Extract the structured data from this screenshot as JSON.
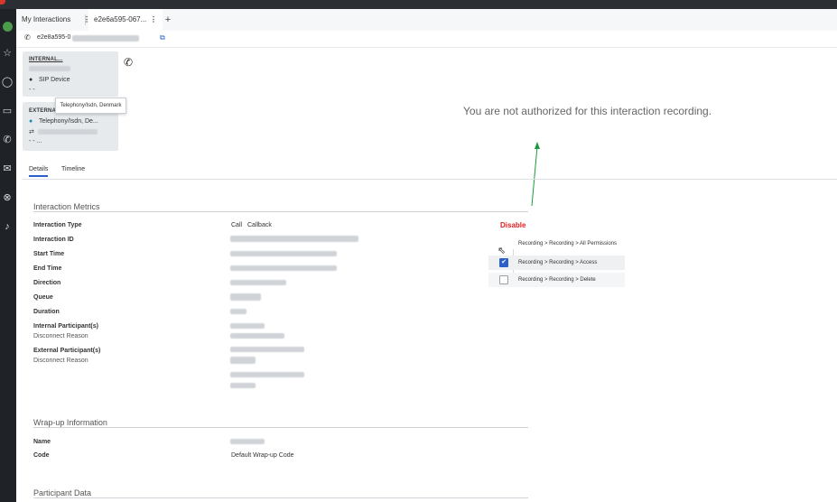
{
  "tabs": {
    "my_interactions": "My Interactions",
    "interaction_tab": "e2e6a595-067...",
    "more_glyph": "⋮",
    "add_glyph": "+"
  },
  "subbar": {
    "interaction_id": "e2e8a595-0"
  },
  "participants": {
    "internal": {
      "title": "INTERNAL...",
      "device": "SIP Device",
      "dashes": "- -"
    },
    "external": {
      "title": "EXTERNA...",
      "device": "Telephony/Isdn, De...",
      "dashes": "- -  ..."
    },
    "tooltip": "Telephony/Isdn, Denmark"
  },
  "recording": {
    "message": "You are not authorized for this interaction recording."
  },
  "detail_tabs": {
    "details": "Details",
    "timeline": "Timeline"
  },
  "metrics": {
    "section_title": "Interaction Metrics",
    "labels": {
      "interaction_type": "Interaction Type",
      "interaction_id": "Interaction ID",
      "start_time": "Start Time",
      "end_time": "End Time",
      "direction": "Direction",
      "queue": "Queue",
      "duration": "Duration",
      "internal_participants": "Internal Participant(s)",
      "internal_disconnect": "Disconnect Reason",
      "external_participants": "External Participant(s)",
      "external_disconnect": "Disconnect Reason"
    },
    "interaction_type_values": [
      "Call",
      "Callback"
    ]
  },
  "wrapup": {
    "section_title": "Wrap-up Information",
    "name_label": "Name",
    "code_label": "Code",
    "code_value": "Default Wrap-up Code"
  },
  "participant_data": {
    "section_title": "Participant Data"
  },
  "annotation": {
    "disable_label": "Disable",
    "permissions": [
      {
        "label": "Recording > Recording > All Permissions",
        "checked": false
      },
      {
        "label": "Recording > Recording > Access",
        "checked": true
      },
      {
        "label": "Recording > Recording > Delete",
        "checked": false
      }
    ],
    "arrow_color": "#1a9a3a"
  },
  "colors": {
    "accent": "#2a60c8",
    "disable_red": "#e02020",
    "card_bg": "#e7eaed"
  }
}
